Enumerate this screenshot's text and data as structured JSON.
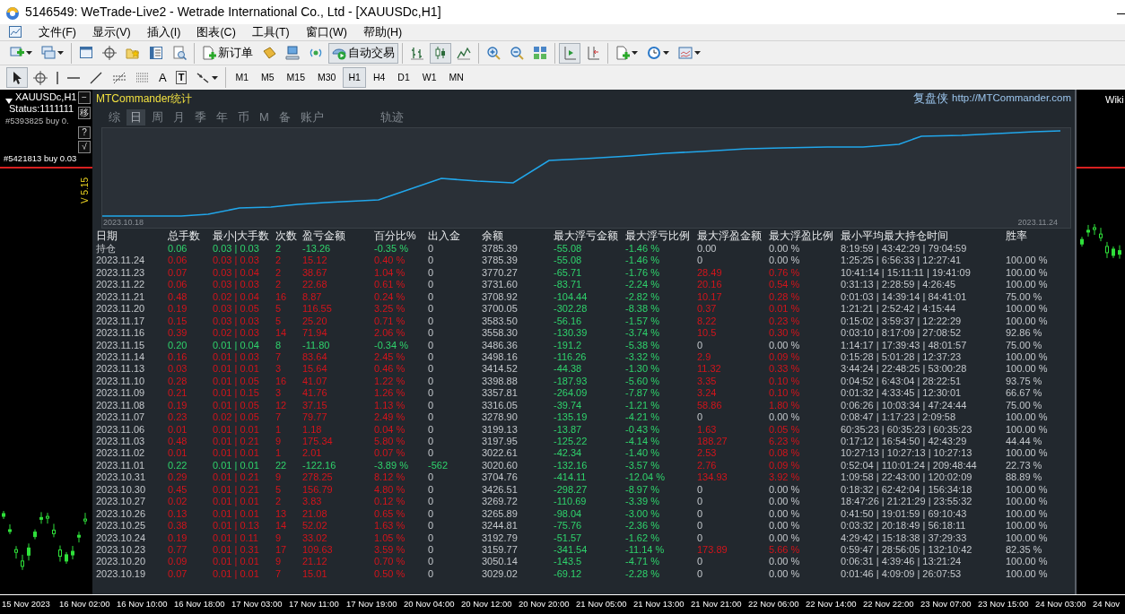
{
  "window": {
    "title": "5146549: WeTrade-Live2 - Wetrade International Co., Ltd - [XAUUSDc,H1]"
  },
  "menu": [
    "文件(F)",
    "显示(V)",
    "插入(I)",
    "图表(C)",
    "工具(T)",
    "窗口(W)",
    "帮助(H)"
  ],
  "toolbar_1": [
    [
      {
        "kind": "icon",
        "selected": false,
        "dropdown": true
      },
      {
        "kind": "icon",
        "selected": false,
        "dropdown": true
      }
    ],
    [
      {
        "kind": "icon",
        "selected": false,
        "dropdown": false
      },
      {
        "kind": "icon",
        "selected": false,
        "dropdown": false
      },
      {
        "kind": "icon",
        "selected": false,
        "dropdown": false
      },
      {
        "kind": "icon",
        "selected": false,
        "dropdown": false
      },
      {
        "kind": "icon",
        "selected": false,
        "dropdown": false
      }
    ],
    [
      {
        "kind": "labeled",
        "label": "新订单",
        "selected": false
      },
      {
        "kind": "icon",
        "selected": false,
        "dropdown": false
      },
      {
        "kind": "icon",
        "selected": false,
        "dropdown": false
      },
      {
        "kind": "icon",
        "selected": false,
        "dropdown": false
      },
      {
        "kind": "labeled",
        "label": "自动交易",
        "selected": true
      }
    ],
    [
      {
        "kind": "icon",
        "selected": false,
        "dropdown": false
      },
      {
        "kind": "icon",
        "selected": true,
        "dropdown": false
      },
      {
        "kind": "icon",
        "selected": false,
        "dropdown": false
      }
    ],
    [
      {
        "kind": "icon",
        "selected": false,
        "dropdown": false
      },
      {
        "kind": "icon",
        "selected": false,
        "dropdown": false
      },
      {
        "kind": "icon",
        "selected": false,
        "dropdown": false
      }
    ],
    [
      {
        "kind": "icon",
        "selected": true,
        "dropdown": false
      },
      {
        "kind": "icon",
        "selected": false,
        "dropdown": false
      }
    ],
    [
      {
        "kind": "icon",
        "selected": false,
        "dropdown": true
      },
      {
        "kind": "icon",
        "selected": false,
        "dropdown": true
      },
      {
        "kind": "icon",
        "selected": false,
        "dropdown": true
      }
    ]
  ],
  "toolbar_2": {
    "tools": [
      {
        "kind": "icon",
        "selected": true
      },
      {
        "kind": "icon",
        "selected": false
      },
      {
        "kind": "icon",
        "selected": false
      },
      {
        "kind": "icon",
        "selected": false
      },
      {
        "kind": "icon",
        "selected": false
      },
      {
        "kind": "icon",
        "selected": false
      },
      {
        "kind": "icon",
        "selected": false
      },
      {
        "kind": "glyph",
        "label": "A",
        "selected": false
      },
      {
        "kind": "boxed_glyph",
        "label": "T",
        "selected": false
      },
      {
        "kind": "icon",
        "selected": false
      }
    ],
    "timeframes": [
      {
        "label": "M1",
        "selected": false
      },
      {
        "label": "M5",
        "selected": false
      },
      {
        "label": "M15",
        "selected": false
      },
      {
        "label": "M30",
        "selected": false
      },
      {
        "label": "H1",
        "selected": true
      },
      {
        "label": "H4",
        "selected": false
      },
      {
        "label": "D1",
        "selected": false
      },
      {
        "label": "W1",
        "selected": false
      },
      {
        "label": "MN",
        "selected": false
      }
    ]
  },
  "chart_window": {
    "symbol": "XAUUSDc,H1",
    "status": "Status:1111111",
    "orders": [
      "#5393825 buy 0.",
      "#5421813 buy 0.03"
    ],
    "panel_buttons": [
      "−",
      "移",
      "?",
      "√"
    ],
    "version": "V 5.15",
    "right_label": "Wiki"
  },
  "stats_panel": {
    "title": "MTCommander统计",
    "brand": "复盘侠",
    "link": "http://MTCommander.com",
    "tabs": [
      {
        "label": "综",
        "selected": false
      },
      {
        "label": "日",
        "selected": true
      },
      {
        "label": "周",
        "selected": false
      },
      {
        "label": "月",
        "selected": false
      },
      {
        "label": "季",
        "selected": false
      },
      {
        "label": "年",
        "selected": false
      },
      {
        "label": "币",
        "selected": false
      },
      {
        "label": "M",
        "selected": false
      },
      {
        "label": "备",
        "selected": false
      },
      {
        "label": "账户",
        "selected": false
      },
      {
        "label": "轨迹",
        "selected": false
      }
    ],
    "equity_curve": {
      "start_label": "2023.10.18",
      "end_label": "2023.11.24"
    },
    "table": {
      "columns": [
        "日期",
        "总手数",
        "最小|大手数",
        "次数",
        "盈亏金额",
        "百分比%",
        "出入金",
        "余额",
        "最大浮亏金额",
        "最大浮亏比例",
        "最大浮盈金额",
        "最大浮盈比例",
        "最小平均最大持仓时间",
        "胜率"
      ],
      "rows": [
        {
          "profit": false,
          "cash_flow": false,
          "float_profit": false,
          "cells": [
            "持仓",
            "0.06",
            "0.03 | 0.03",
            "2",
            "-13.26",
            "-0.35 %",
            "0",
            "3785.39",
            "-55.08",
            "-1.46 %",
            "0.00",
            "0.00 %",
            "8:19:59 | 43:42:29 | 79:04:59"
          ]
        },
        {
          "profit": true,
          "cash_flow": false,
          "float_profit": false,
          "cells": [
            "2023.11.24",
            "0.06",
            "0.03 | 0.03",
            "2",
            "15.12",
            "0.40 %",
            "0",
            "3785.39",
            "-55.08",
            "-1.46 %",
            "0",
            "0.00 %",
            "1:25:25 | 6:56:33 | 12:27:41",
            "100.00 %"
          ]
        },
        {
          "profit": true,
          "cash_flow": false,
          "float_profit": true,
          "cells": [
            "2023.11.23",
            "0.07",
            "0.03 | 0.04",
            "2",
            "38.67",
            "1.04 %",
            "0",
            "3770.27",
            "-65.71",
            "-1.76 %",
            "28.49",
            "0.76 %",
            "10:41:14 | 15:11:11 | 19:41:09",
            "100.00 %"
          ]
        },
        {
          "profit": true,
          "cash_flow": false,
          "float_profit": true,
          "cells": [
            "2023.11.22",
            "0.06",
            "0.03 | 0.03",
            "2",
            "22.68",
            "0.61 %",
            "0",
            "3731.60",
            "-83.71",
            "-2.24 %",
            "20.16",
            "0.54 %",
            "0:31:13 | 2:28:59 | 4:26:45",
            "100.00 %"
          ]
        },
        {
          "profit": true,
          "cash_flow": false,
          "float_profit": true,
          "cells": [
            "2023.11.21",
            "0.48",
            "0.02 | 0.04",
            "16",
            "8.87",
            "0.24 %",
            "0",
            "3708.92",
            "-104.44",
            "-2.82 %",
            "10.17",
            "0.28 %",
            "0:01:03 | 14:39:14 | 84:41:01",
            "75.00 %"
          ]
        },
        {
          "profit": true,
          "cash_flow": false,
          "float_profit": true,
          "cells": [
            "2023.11.20",
            "0.19",
            "0.03 | 0.05",
            "5",
            "116.55",
            "3.25 %",
            "0",
            "3700.05",
            "-302.28",
            "-8.38 %",
            "0.37",
            "0.01 %",
            "1:21:21 | 2:52:42 | 4:15:44",
            "100.00 %"
          ]
        },
        {
          "profit": true,
          "cash_flow": false,
          "float_profit": true,
          "cells": [
            "2023.11.17",
            "0.15",
            "0.03 | 0.03",
            "5",
            "25.20",
            "0.71 %",
            "0",
            "3583.50",
            "-56.16",
            "-1.57 %",
            "8.22",
            "0.23 %",
            "0:15:02 | 3:59:37 | 12:22:29",
            "100.00 %"
          ]
        },
        {
          "profit": true,
          "cash_flow": false,
          "float_profit": true,
          "cells": [
            "2023.11.16",
            "0.39",
            "0.02 | 0.03",
            "14",
            "71.94",
            "2.06 %",
            "0",
            "3558.30",
            "-130.39",
            "-3.74 %",
            "10.5",
            "0.30 %",
            "0:03:10 | 8:17:09 | 27:08:52",
            "92.86 %"
          ]
        },
        {
          "profit": false,
          "cash_flow": false,
          "float_profit": false,
          "cells": [
            "2023.11.15",
            "0.20",
            "0.01 | 0.04",
            "8",
            "-11.80",
            "-0.34 %",
            "0",
            "3486.36",
            "-191.2",
            "-5.38 %",
            "0",
            "0.00 %",
            "1:14:17 | 17:39:43 | 48:01:57",
            "75.00 %"
          ]
        },
        {
          "profit": true,
          "cash_flow": false,
          "float_profit": true,
          "cells": [
            "2023.11.14",
            "0.16",
            "0.01 | 0.03",
            "7",
            "83.64",
            "2.45 %",
            "0",
            "3498.16",
            "-116.26",
            "-3.32 %",
            "2.9",
            "0.09 %",
            "0:15:28 | 5:01:28 | 12:37:23",
            "100.00 %"
          ]
        },
        {
          "profit": true,
          "cash_flow": false,
          "float_profit": true,
          "cells": [
            "2023.11.13",
            "0.03",
            "0.01 | 0.01",
            "3",
            "15.64",
            "0.46 %",
            "0",
            "3414.52",
            "-44.38",
            "-1.30 %",
            "11.32",
            "0.33 %",
            "3:44:24 | 22:48:25 | 53:00:28",
            "100.00 %"
          ]
        },
        {
          "profit": true,
          "cash_flow": false,
          "float_profit": true,
          "cells": [
            "2023.11.10",
            "0.28",
            "0.01 | 0.05",
            "16",
            "41.07",
            "1.22 %",
            "0",
            "3398.88",
            "-187.93",
            "-5.60 %",
            "3.35",
            "0.10 %",
            "0:04:52 | 6:43:04 | 28:22:51",
            "93.75 %"
          ]
        },
        {
          "profit": true,
          "cash_flow": false,
          "float_profit": true,
          "cells": [
            "2023.11.09",
            "0.21",
            "0.01 | 0.15",
            "3",
            "41.76",
            "1.26 %",
            "0",
            "3357.81",
            "-264.09",
            "-7.87 %",
            "3.24",
            "0.10 %",
            "0:01:32 | 4:33:45 | 12:30:01",
            "66.67 %"
          ]
        },
        {
          "profit": true,
          "cash_flow": false,
          "float_profit": true,
          "cells": [
            "2023.11.08",
            "0.19",
            "0.01 | 0.05",
            "12",
            "37.15",
            "1.13 %",
            "0",
            "3316.05",
            "-39.74",
            "-1.21 %",
            "58.86",
            "1.80 %",
            "0:06:26 | 10:03:34 | 47:24:44",
            "75.00 %"
          ]
        },
        {
          "profit": true,
          "cash_flow": false,
          "float_profit": false,
          "cells": [
            "2023.11.07",
            "0.23",
            "0.02 | 0.05",
            "7",
            "79.77",
            "2.49 %",
            "0",
            "3278.90",
            "-135.19",
            "-4.21 %",
            "0",
            "0.00 %",
            "0:08:47 | 1:17:23 | 2:09:58",
            "100.00 %"
          ]
        },
        {
          "profit": true,
          "cash_flow": false,
          "float_profit": true,
          "cells": [
            "2023.11.06",
            "0.01",
            "0.01 | 0.01",
            "1",
            "1.18",
            "0.04 %",
            "0",
            "3199.13",
            "-13.87",
            "-0.43 %",
            "1.63",
            "0.05 %",
            "60:35:23 | 60:35:23 | 60:35:23",
            "100.00 %"
          ]
        },
        {
          "profit": true,
          "cash_flow": false,
          "float_profit": true,
          "cells": [
            "2023.11.03",
            "0.48",
            "0.01 | 0.21",
            "9",
            "175.34",
            "5.80 %",
            "0",
            "3197.95",
            "-125.22",
            "-4.14 %",
            "188.27",
            "6.23 %",
            "0:17:12 | 16:54:50 | 42:43:29",
            "44.44 %"
          ]
        },
        {
          "profit": true,
          "cash_flow": false,
          "float_profit": true,
          "cells": [
            "2023.11.02",
            "0.01",
            "0.01 | 0.01",
            "1",
            "2.01",
            "0.07 %",
            "0",
            "3022.61",
            "-42.34",
            "-1.40 %",
            "2.53",
            "0.08 %",
            "10:27:13 | 10:27:13 | 10:27:13",
            "100.00 %"
          ]
        },
        {
          "profit": false,
          "cash_flow": true,
          "float_profit": true,
          "cells": [
            "2023.11.01",
            "0.22",
            "0.01 | 0.01",
            "22",
            "-122.16",
            "-3.89 %",
            "-562",
            "3020.60",
            "-132.16",
            "-3.57 %",
            "2.76",
            "0.09 %",
            "0:52:04 | 110:01:24 | 209:48:44",
            "22.73 %"
          ]
        },
        {
          "profit": true,
          "cash_flow": false,
          "float_profit": true,
          "cells": [
            "2023.10.31",
            "0.29",
            "0.01 | 0.21",
            "9",
            "278.25",
            "8.12 %",
            "0",
            "3704.76",
            "-414.11",
            "-12.04 %",
            "134.93",
            "3.92 %",
            "1:09:58 | 22:43:00 | 120:02:09",
            "88.89 %"
          ]
        },
        {
          "profit": true,
          "cash_flow": false,
          "float_profit": false,
          "cells": [
            "2023.10.30",
            "0.45",
            "0.01 | 0.21",
            "5",
            "156.79",
            "4.80 %",
            "0",
            "3426.51",
            "-298.27",
            "-8.97 %",
            "0",
            "0.00 %",
            "0:18:32 | 62:42:04 | 156:34:18",
            "100.00 %"
          ]
        },
        {
          "profit": true,
          "cash_flow": false,
          "float_profit": false,
          "cells": [
            "2023.10.27",
            "0.02",
            "0.01 | 0.01",
            "2",
            "3.83",
            "0.12 %",
            "0",
            "3269.72",
            "-110.69",
            "-3.39 %",
            "0",
            "0.00 %",
            "18:47:26 | 21:21:29 | 23:55:32",
            "100.00 %"
          ]
        },
        {
          "profit": true,
          "cash_flow": false,
          "float_profit": false,
          "cells": [
            "2023.10.26",
            "0.13",
            "0.01 | 0.01",
            "13",
            "21.08",
            "0.65 %",
            "0",
            "3265.89",
            "-98.04",
            "-3.00 %",
            "0",
            "0.00 %",
            "0:41:50 | 19:01:59 | 69:10:43",
            "100.00 %"
          ]
        },
        {
          "profit": true,
          "cash_flow": false,
          "float_profit": false,
          "cells": [
            "2023.10.25",
            "0.38",
            "0.01 | 0.13",
            "14",
            "52.02",
            "1.63 %",
            "0",
            "3244.81",
            "-75.76",
            "-2.36 %",
            "0",
            "0.00 %",
            "0:03:32 | 20:18:49 | 56:18:11",
            "100.00 %"
          ]
        },
        {
          "profit": true,
          "cash_flow": false,
          "float_profit": false,
          "cells": [
            "2023.10.24",
            "0.19",
            "0.01 | 0.11",
            "9",
            "33.02",
            "1.05 %",
            "0",
            "3192.79",
            "-51.57",
            "-1.62 %",
            "0",
            "0.00 %",
            "4:29:42 | 15:18:38 | 37:29:33",
            "100.00 %"
          ]
        },
        {
          "profit": true,
          "cash_flow": false,
          "float_profit": true,
          "cells": [
            "2023.10.23",
            "0.77",
            "0.01 | 0.31",
            "17",
            "109.63",
            "3.59 %",
            "0",
            "3159.77",
            "-341.54",
            "-11.14 %",
            "173.89",
            "5.66 %",
            "0:59:47 | 28:56:05 | 132:10:42",
            "82.35 %"
          ]
        },
        {
          "profit": true,
          "cash_flow": false,
          "float_profit": false,
          "cells": [
            "2023.10.20",
            "0.09",
            "0.01 | 0.01",
            "9",
            "21.12",
            "0.70 %",
            "0",
            "3050.14",
            "-143.5",
            "-4.71 %",
            "0",
            "0.00 %",
            "0:06:31 | 4:39:46 | 13:21:24",
            "100.00 %"
          ]
        },
        {
          "profit": true,
          "cash_flow": false,
          "float_profit": false,
          "cells": [
            "2023.10.19",
            "0.07",
            "0.01 | 0.01",
            "7",
            "15.01",
            "0.50 %",
            "0",
            "3029.02",
            "-69.12",
            "-2.28 %",
            "0",
            "0.00 %",
            "0:01:46 | 4:09:09 | 26:07:53",
            "100.00 %"
          ]
        }
      ]
    }
  },
  "time_axis": [
    "15 Nov 2023",
    "16 Nov 02:00",
    "16 Nov 10:00",
    "16 Nov 18:00",
    "17 Nov 03:00",
    "17 Nov 11:00",
    "17 Nov 19:00",
    "20 Nov 04:00",
    "20 Nov 12:00",
    "20 Nov 20:00",
    "21 Nov 05:00",
    "21 Nov 13:00",
    "21 Nov 21:00",
    "22 Nov 06:00",
    "22 Nov 14:00",
    "22 Nov 22:00",
    "23 Nov 07:00",
    "23 Nov 15:00",
    "24 Nov 03:00",
    "24 Nov"
  ]
}
